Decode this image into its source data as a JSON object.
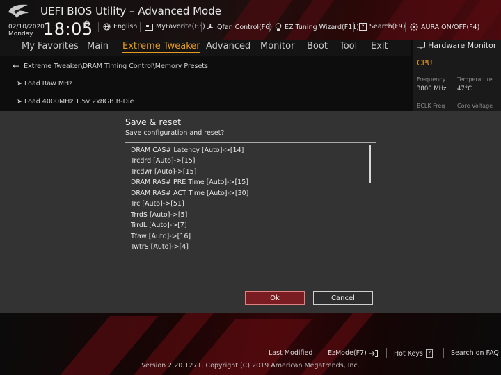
{
  "header": {
    "title": "UEFI BIOS Utility – Advanced Mode",
    "date": "02/10/2020",
    "day": "Monday",
    "time": "18:05",
    "toolbar": [
      {
        "id": "lang",
        "label": "English",
        "icon": "globe-icon"
      },
      {
        "id": "fav",
        "label": "MyFavorite(F3)",
        "icon": "favorite-icon"
      },
      {
        "id": "qfan",
        "label": "Qfan Control(F6)",
        "icon": "fan-icon"
      },
      {
        "id": "ez",
        "label": "EZ Tuning Wizard(F11)",
        "icon": "bulb-icon"
      },
      {
        "id": "search",
        "label": "Search(F9)",
        "icon": "search-icon"
      },
      {
        "id": "aura",
        "label": "AURA ON/OFF(F4)",
        "icon": "aura-icon"
      }
    ]
  },
  "nav": {
    "tabs": [
      "My Favorites",
      "Main",
      "Extreme Tweaker",
      "Advanced",
      "Monitor",
      "Boot",
      "Tool",
      "Exit"
    ],
    "active": "Extreme Tweaker"
  },
  "breadcrumb": "Extreme Tweaker\\DRAM Timing Control\\Memory Presets",
  "presets": [
    "Load Raw MHz",
    "Load 4000MHz 1.5v 2x8GB B-Die"
  ],
  "hw_monitor": {
    "title": "Hardware Monitor",
    "section": "CPU",
    "labels": [
      "Frequency",
      "Temperature",
      "BCLK Freq",
      "Core Voltage"
    ],
    "frequency": "3800 MHz",
    "temperature": "47°C"
  },
  "dialog": {
    "title": "Save & reset",
    "subtitle": "Save configuration and reset?",
    "changes": [
      "DRAM CAS# Latency [Auto]->[14]",
      "Trcdrd [Auto]->[15]",
      "Trcdwr [Auto]->[15]",
      "DRAM RAS# PRE Time [Auto]->[15]",
      "DRAM RAS# ACT Time [Auto]->[30]",
      "Trc [Auto]->[51]",
      "TrrdS [Auto]->[5]",
      "TrrdL [Auto]->[7]",
      "Tfaw [Auto]->[16]",
      "TwtrS [Auto]->[4]"
    ],
    "ok_label": "Ok",
    "cancel_label": "Cancel"
  },
  "footer": {
    "last_modified": "Last Modified",
    "ezmode": "EzMode(F7)",
    "hotkeys": "Hot Keys",
    "hotkeys_key": "?",
    "faq": "Search on FAQ",
    "version": "Version 2.20.1271. Copyright (C) 2019 American Megatrends, Inc."
  },
  "colors": {
    "accent": "#e79c1e",
    "ok_button": "#7a1d22",
    "header_red": "#4a0a0e"
  }
}
